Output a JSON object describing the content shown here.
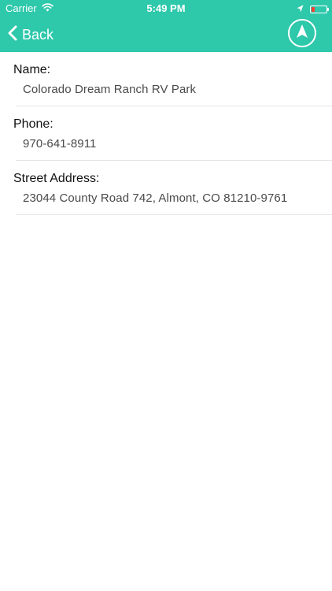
{
  "status_bar": {
    "carrier": "Carrier",
    "time": "5:49 PM",
    "battery_color": "#ff3b30"
  },
  "nav": {
    "back_label": "Back",
    "back_icon": "chevron-left-icon",
    "location_icon": "navigation-arrow-icon",
    "bar_color": "#2ec8ab"
  },
  "details": {
    "name": {
      "label": "Name:",
      "value": "Colorado Dream Ranch RV Park"
    },
    "phone": {
      "label": "Phone:",
      "value": "970-641-8911"
    },
    "address": {
      "label": "Street Address:",
      "value": "23044 County Road 742, Almont, CO 81210-9761"
    }
  }
}
